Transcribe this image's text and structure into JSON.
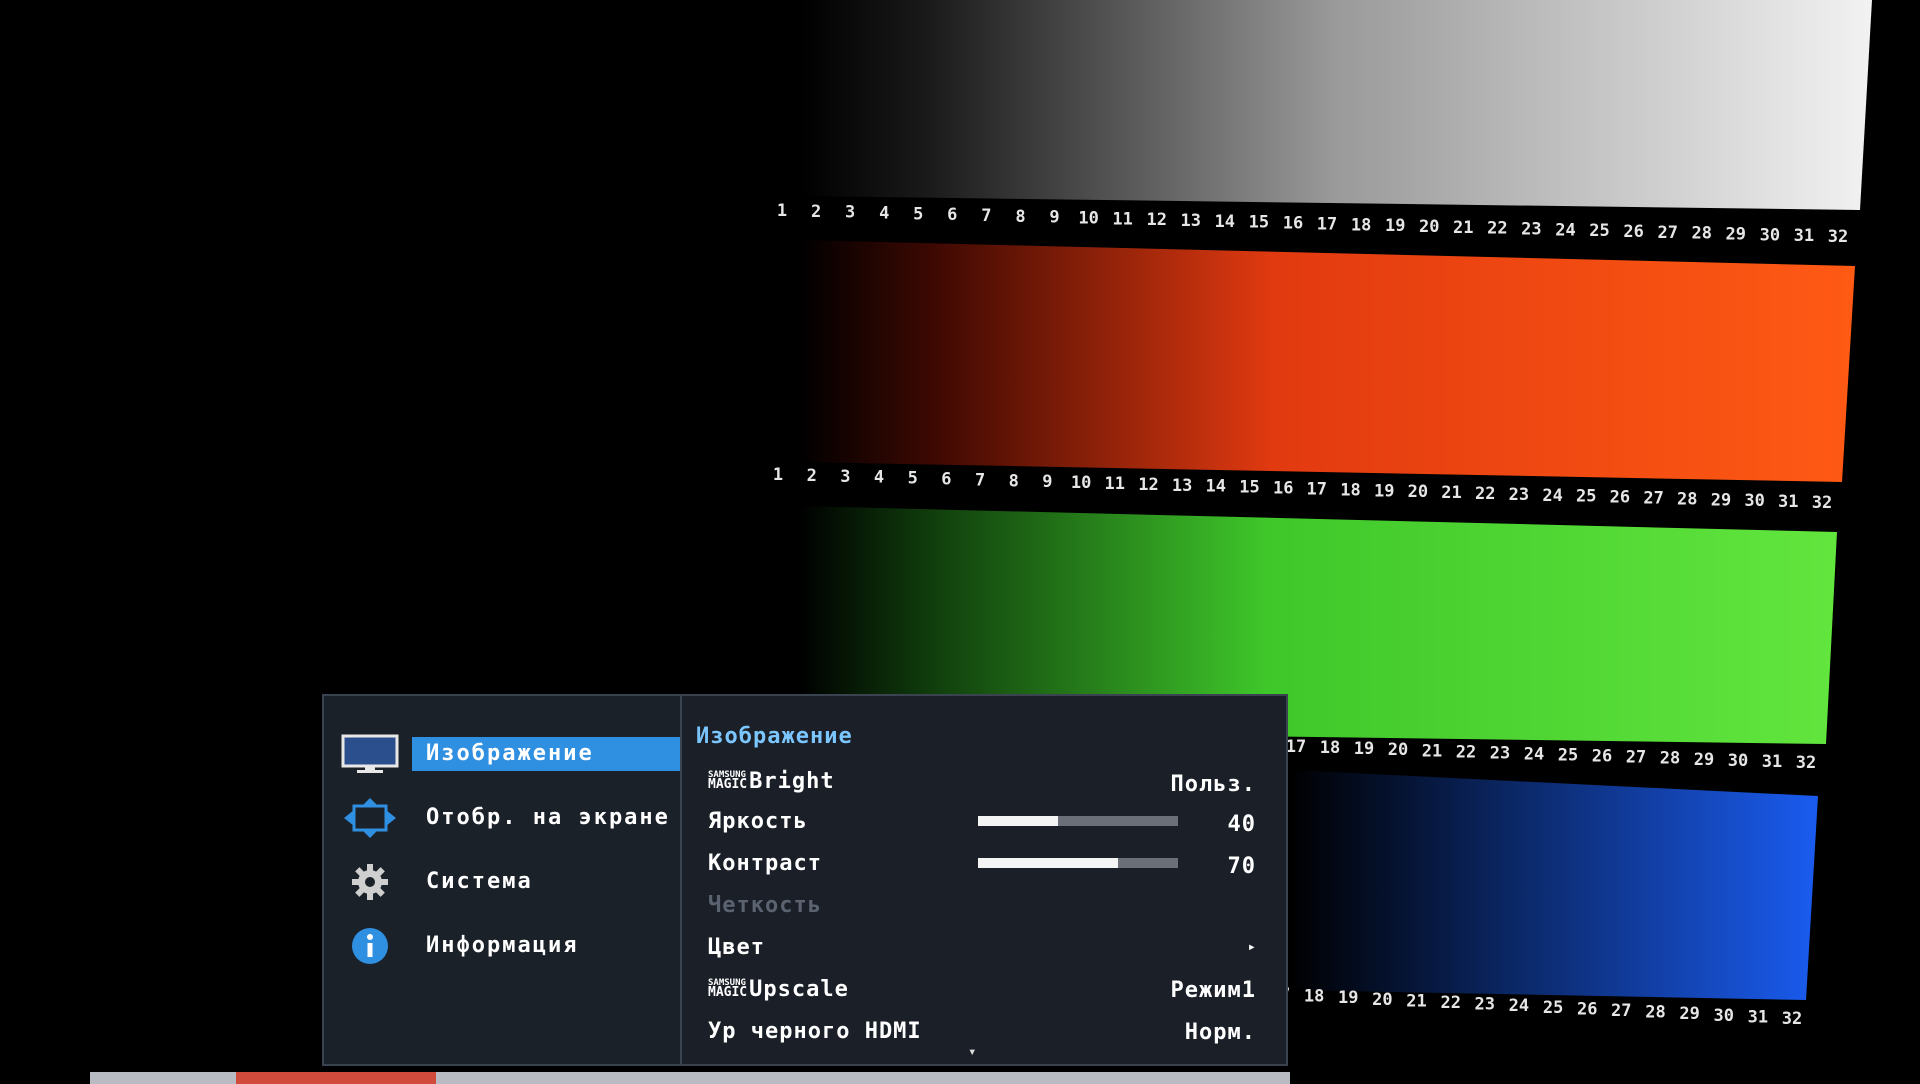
{
  "test_pattern": {
    "row_numbers": [
      "1",
      "2",
      "3",
      "4",
      "5",
      "6",
      "7",
      "8",
      "9",
      "10",
      "11",
      "12",
      "13",
      "14",
      "15",
      "16",
      "17",
      "18",
      "19",
      "20",
      "21",
      "22",
      "23",
      "24",
      "25",
      "26",
      "27",
      "28",
      "29",
      "30",
      "31",
      "32"
    ],
    "bands": [
      {
        "name": "gray",
        "color_start": "#000000",
        "color_end": "#f2f2f2"
      },
      {
        "name": "red",
        "color_start": "#000000",
        "color_end": "#ff5a14"
      },
      {
        "name": "green",
        "color_start": "#000000",
        "color_end": "#5ee23a"
      },
      {
        "name": "blue",
        "color_start": "#000000",
        "color_end": "#1a5cf0"
      }
    ]
  },
  "osd": {
    "main_menu": [
      {
        "label": "Изображение",
        "icon": "monitor-icon",
        "active": true
      },
      {
        "label": "Отобр. на экране",
        "icon": "move-arrows-icon",
        "active": false
      },
      {
        "label": "Система",
        "icon": "gear-icon",
        "active": false
      },
      {
        "label": "Информация",
        "icon": "info-icon",
        "active": false
      }
    ],
    "sub_menu": {
      "title": "Изображение",
      "magic_brand_top": "SAMSUNG",
      "magic_brand_bottom": "MAGIC",
      "items": [
        {
          "label": "Bright",
          "magic": true,
          "value": "Польз."
        },
        {
          "label": "Яркость",
          "slider": 40,
          "value": "40"
        },
        {
          "label": "Контраст",
          "slider": 70,
          "value": "70"
        },
        {
          "label": "Четкость",
          "disabled": true
        },
        {
          "label": "Цвет",
          "submenu": true,
          "arrow": "▸"
        },
        {
          "label": "Upscale",
          "magic": true,
          "value": "Режим1"
        },
        {
          "label": "Ур черного HDMI",
          "value": "Норм."
        }
      ],
      "scroll_arrow": "▾"
    },
    "accent_color": "#2f8fe0",
    "title_color": "#7cc6ff"
  }
}
